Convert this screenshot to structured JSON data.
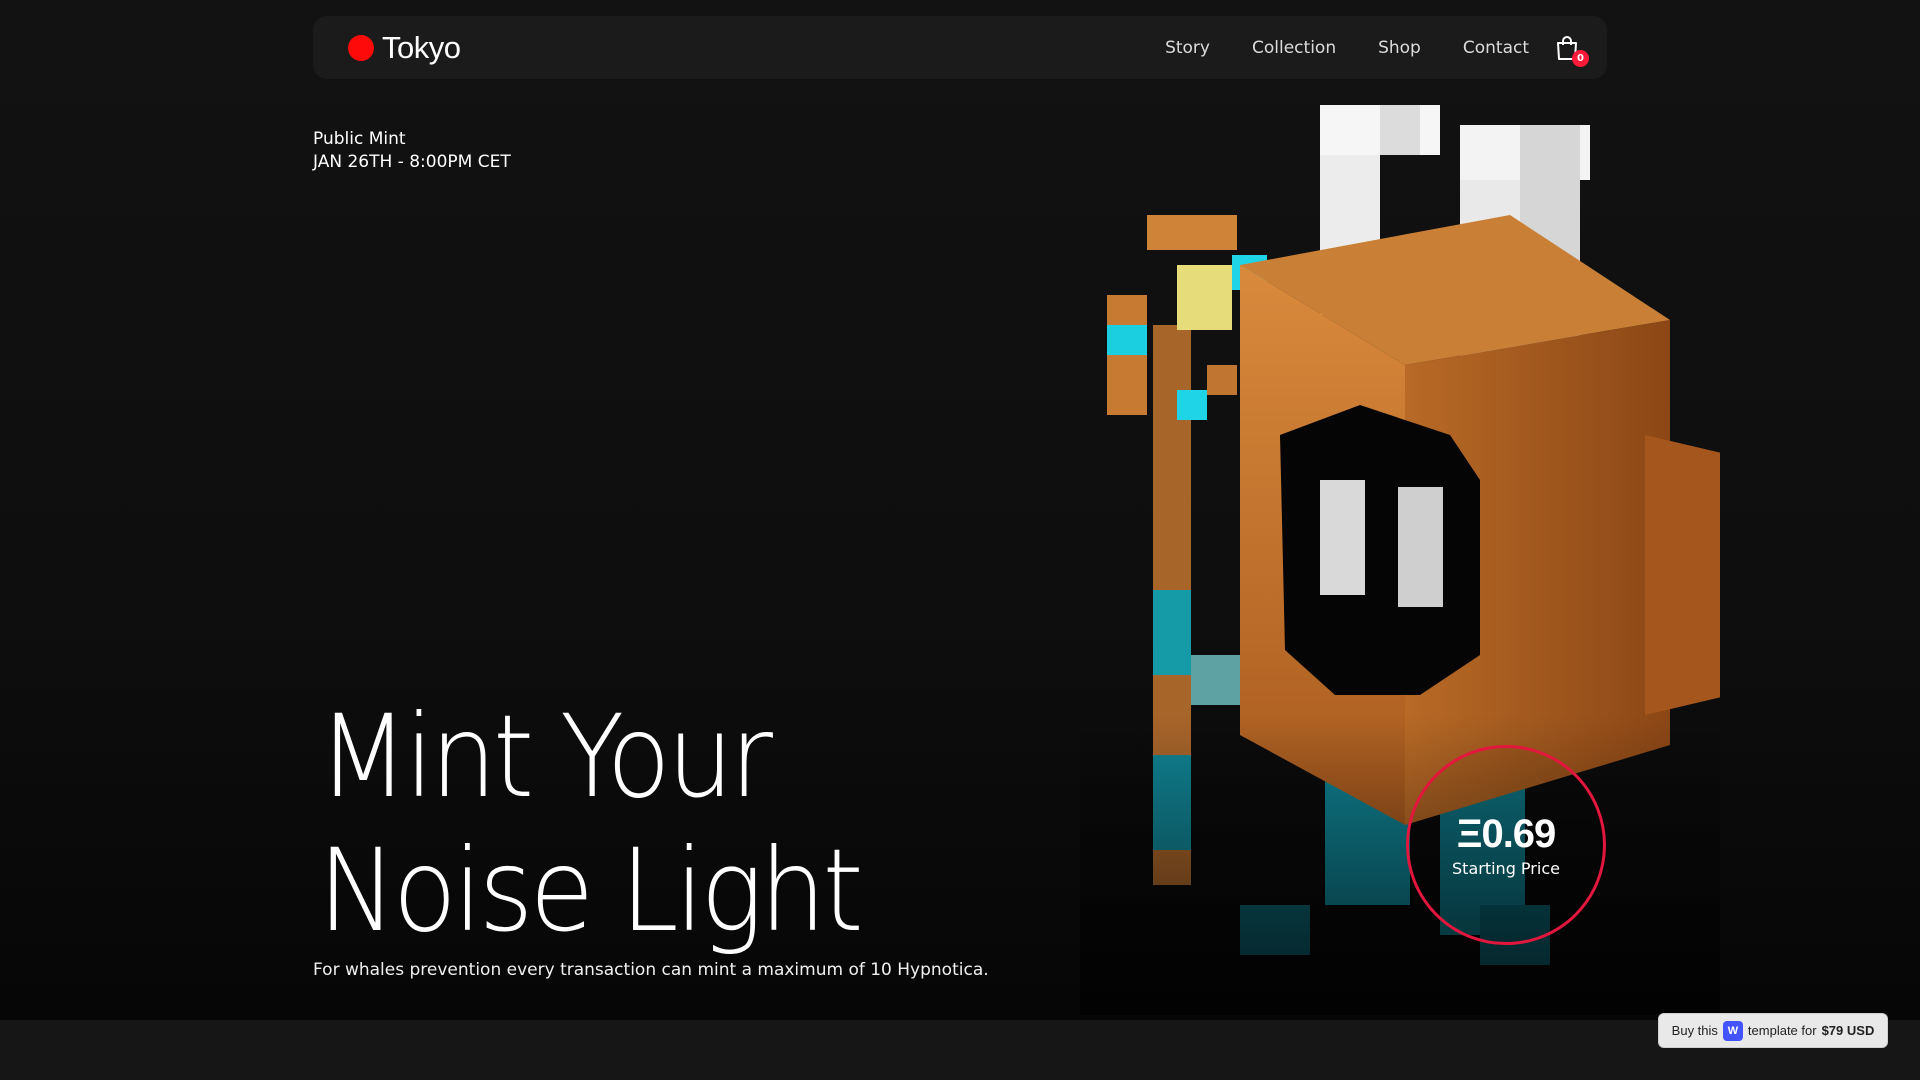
{
  "nav": {
    "brand": "Tokyo",
    "links": [
      "Story",
      "Collection",
      "Shop",
      "Contact"
    ],
    "cart_count": "0",
    "brand_color": "#ff0a0a"
  },
  "mint": {
    "label": "Public Mint",
    "date": "JAN 26TH - 8:00PM CET"
  },
  "hero": {
    "headline_line1": "Mint Your",
    "headline_line2": "Noise Light",
    "subtext": "For whales prevention every transaction can mint a maximum of 10 Hypnotica."
  },
  "price": {
    "value": "Ξ0.69",
    "label": "Starting Price",
    "ring_color": "#e3173d"
  },
  "buy_badge": {
    "prefix": "Buy this",
    "logo": "W",
    "middle": "template for",
    "price": "$79 USD"
  },
  "icons": {
    "cart": "shopping-bag-icon",
    "character": "voxel-robot-character"
  }
}
